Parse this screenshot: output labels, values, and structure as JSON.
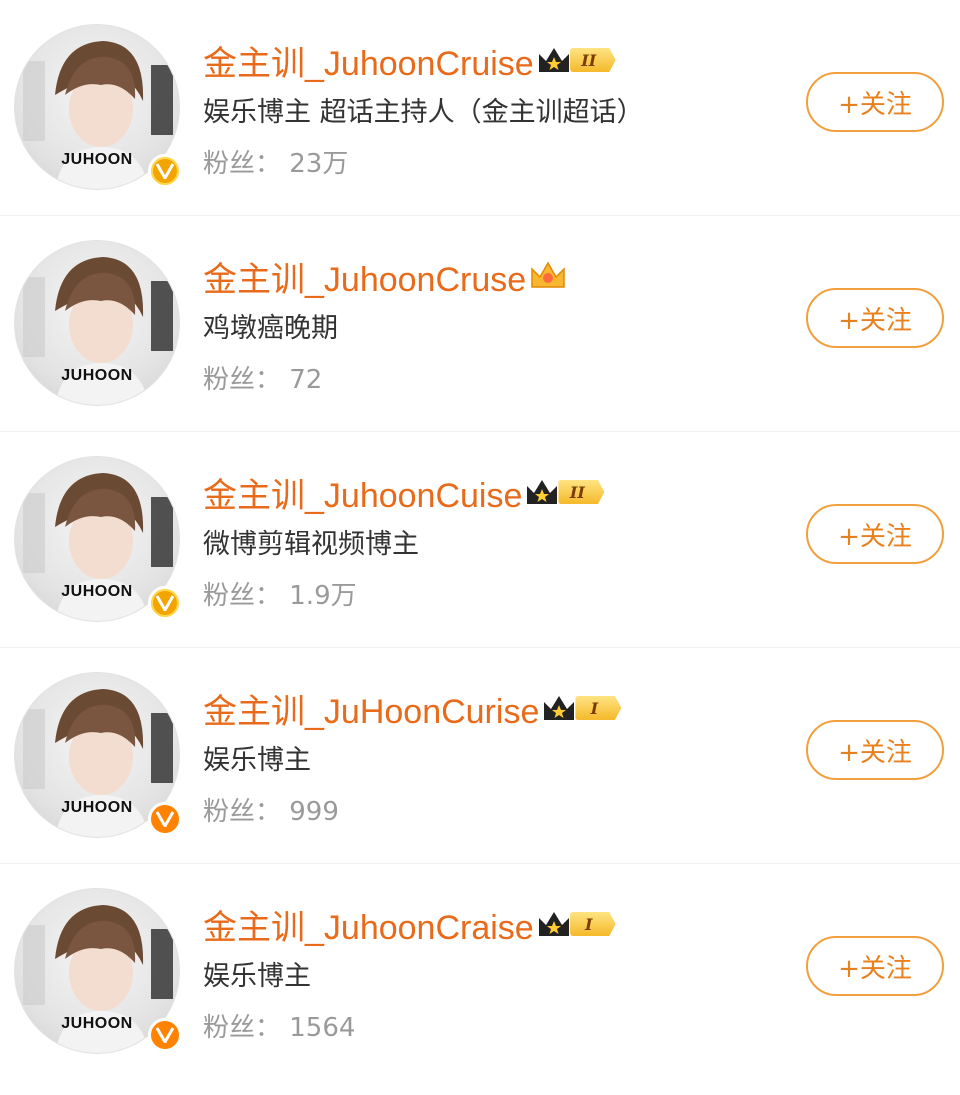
{
  "colors": {
    "name": "#e86a1b",
    "accent": "#ff8200",
    "muted": "#9a9a9a",
    "button_border": "#f0a03e"
  },
  "follow_label": "+关注",
  "results": [
    {
      "name": "金主训_JuhoonCruise",
      "badge": "crown-II-icon",
      "level": "II",
      "verified": "v-gold-icon",
      "desc": "娱乐博主 超话主持人（金主训超话）",
      "fans": "粉丝： 23万",
      "avatar_text": "JUHOON"
    },
    {
      "name": "金主训_JuhoonCruse",
      "badge": "crown-icon",
      "level": "",
      "verified": "",
      "desc": "鸡墩癌晚期",
      "fans": "粉丝： 72",
      "avatar_text": "JUHOON"
    },
    {
      "name": "金主训_JuhoonCuise",
      "badge": "crown-II-icon",
      "level": "II",
      "verified": "v-orange-icon",
      "desc": "微博剪辑视频博主",
      "fans": "粉丝： 1.9万",
      "avatar_text": "JUHOON"
    },
    {
      "name": "金主训_JuHoonCurise",
      "badge": "crown-I-icon",
      "level": "I",
      "verified": "v-orange-icon",
      "desc": "娱乐博主",
      "fans": "粉丝： 999",
      "avatar_text": "JUHOON"
    },
    {
      "name": "金主训_JuhoonCraise",
      "badge": "crown-I-icon",
      "level": "I",
      "verified": "v-orange-icon",
      "desc": "娱乐博主",
      "fans": "粉丝： 1564",
      "avatar_text": "JUHOON"
    }
  ]
}
